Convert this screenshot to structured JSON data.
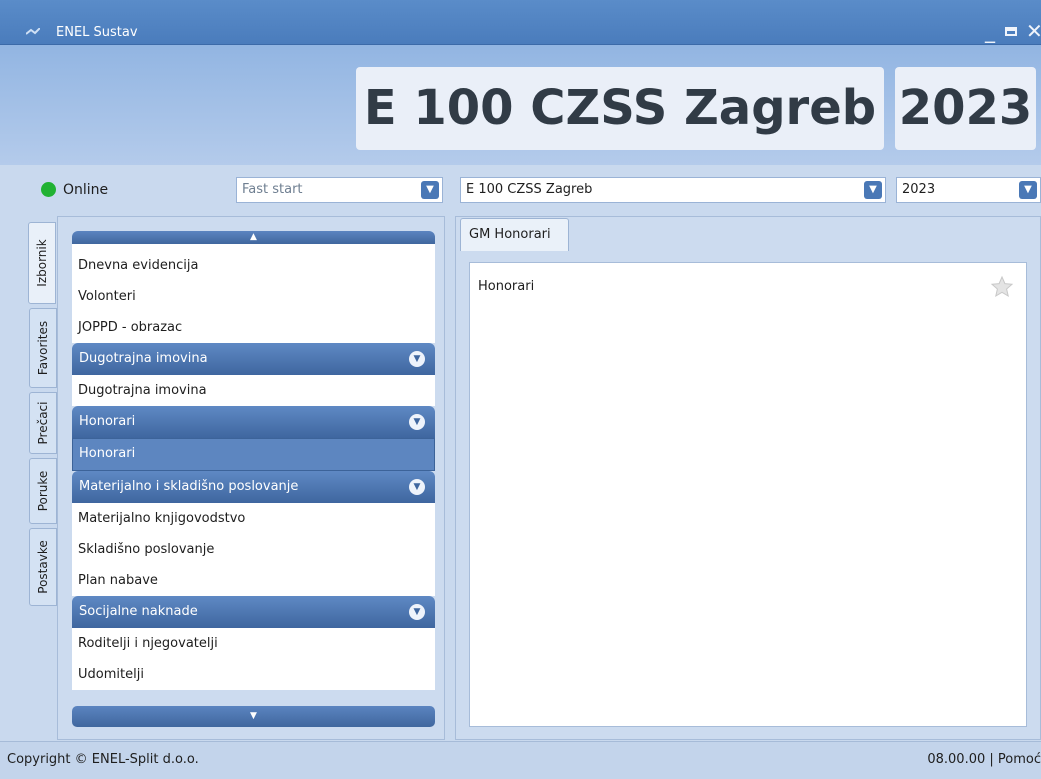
{
  "window": {
    "title": "ENEL Sustav",
    "min_glyph": "_",
    "close_glyph": "✕"
  },
  "header": {
    "organization": "E 100 CZSS Zagreb",
    "year": "2023"
  },
  "status": {
    "text": "Online",
    "color": "#21b233"
  },
  "toolbar": {
    "fast_start_placeholder": "Fast start",
    "org_select": "E 100 CZSS Zagreb",
    "year_select": "2023",
    "dropdown_glyph": "▼"
  },
  "vertical_tabs": [
    "Izbornik",
    "Favorites",
    "Prečaci",
    "Poruke",
    "Postavke"
  ],
  "menu": {
    "scroll_up_glyph": "▲",
    "scroll_down_glyph": "▼",
    "chevron_glyph": "▼",
    "groups": [
      {
        "title": "",
        "items": [
          "Dnevna evidencija",
          "Volonteri",
          "JOPPD - obrazac"
        ]
      },
      {
        "title": "Dugotrajna imovina",
        "items": [
          "Dugotrajna imovina"
        ]
      },
      {
        "title": "Honorari",
        "items": [
          "Honorari"
        ],
        "selected": "Honorari"
      },
      {
        "title": "Materijalno i skladišno poslovanje",
        "items": [
          "Materijalno knjigovodstvo",
          "Skladišno poslovanje",
          "Plan nabave"
        ]
      },
      {
        "title": "Socijalne naknade",
        "items": [
          "Roditelji i njegovatelji",
          "Udomitelji"
        ]
      }
    ]
  },
  "content": {
    "tab_label": "GM Honorari",
    "item_label": "Honorari",
    "favorite_icon": "star-icon"
  },
  "footer": {
    "copyright": "Copyright © ENEL-Split d.o.o.",
    "version": "08.00.00 | Pomoć"
  },
  "colors": {
    "accent": "#4a78b6",
    "group_header": "#3f669f",
    "selected": "#5d86c0",
    "background": "#c9d9ee"
  }
}
